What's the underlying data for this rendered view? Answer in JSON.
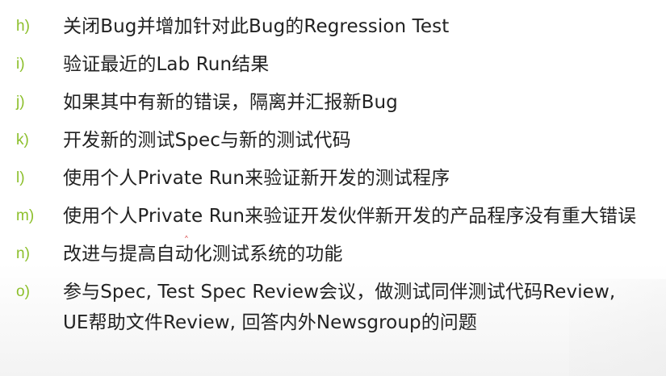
{
  "slide": {
    "items": [
      {
        "marker": "h)",
        "text": "关闭Bug并增加针对此Bug的Regression Test"
      },
      {
        "marker": "i)",
        "text": "验证最近的Lab Run结果"
      },
      {
        "marker": "j)",
        "text": "如果其中有新的错误，隔离并汇报新Bug"
      },
      {
        "marker": "k)",
        "text": "开发新的测试Spec与新的测试代码"
      },
      {
        "marker": "l)",
        "text": "使用个人Private Run来验证新开发的测试程序"
      },
      {
        "marker": "m)",
        "text": "使用个人Private Run来验证开发伙伴新开发的产品程序没有重大错误"
      },
      {
        "marker": "n)",
        "text": "改进与提高自动化测试系统的功能"
      },
      {
        "marker": "o)",
        "text": "参与Spec, Test Spec Review会议，做测试同伴测试代码Review, UE帮助文件Review, 回答内外Newsgroup的问题"
      }
    ],
    "artifact": "^",
    "colors": {
      "marker": "#8cbf2b",
      "text": "#222222",
      "background": "#ffffff"
    }
  }
}
